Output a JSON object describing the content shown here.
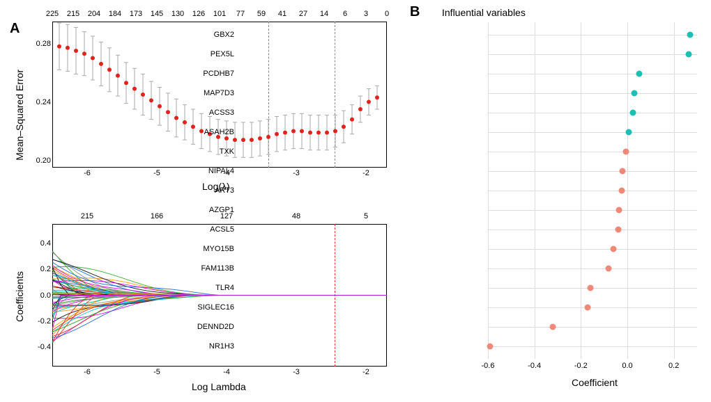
{
  "panels": {
    "A": "A",
    "B": "B"
  },
  "chart_data": [
    {
      "id": "panelA_top",
      "type": "line",
      "title": "",
      "xlabel": "Log(λ)",
      "ylabel": "Mean–Squared Error",
      "xlim": [
        -6.5,
        -1.7
      ],
      "ylim": [
        0.195,
        0.295
      ],
      "y_ticks": [
        0.2,
        0.24,
        0.28
      ],
      "top_axis_label": "",
      "top_ticks": [
        225,
        215,
        204,
        184,
        173,
        145,
        130,
        126,
        101,
        77,
        59,
        41,
        27,
        14,
        6,
        3,
        0
      ],
      "x": [
        -6.4,
        -6.28,
        -6.16,
        -6.04,
        -5.92,
        -5.8,
        -5.68,
        -5.56,
        -5.44,
        -5.32,
        -5.2,
        -5.08,
        -4.96,
        -4.84,
        -4.72,
        -4.6,
        -4.48,
        -4.36,
        -4.24,
        -4.12,
        -4.0,
        -3.88,
        -3.76,
        -3.64,
        -3.52,
        -3.4,
        -3.28,
        -3.16,
        -3.04,
        -2.92,
        -2.8,
        -2.68,
        -2.56,
        -2.44,
        -2.32,
        -2.2,
        -2.08,
        -1.96,
        -1.84
      ],
      "mse": [
        0.278,
        0.277,
        0.275,
        0.273,
        0.27,
        0.266,
        0.262,
        0.258,
        0.253,
        0.249,
        0.245,
        0.241,
        0.237,
        0.233,
        0.229,
        0.226,
        0.223,
        0.22,
        0.218,
        0.216,
        0.215,
        0.214,
        0.214,
        0.214,
        0.215,
        0.216,
        0.218,
        0.219,
        0.22,
        0.22,
        0.219,
        0.219,
        0.219,
        0.22,
        0.223,
        0.228,
        0.235,
        0.24,
        0.243
      ],
      "se": [
        0.016,
        0.016,
        0.016,
        0.015,
        0.015,
        0.015,
        0.015,
        0.014,
        0.014,
        0.014,
        0.014,
        0.013,
        0.013,
        0.013,
        0.013,
        0.012,
        0.012,
        0.012,
        0.012,
        0.012,
        0.012,
        0.012,
        0.012,
        0.012,
        0.012,
        0.012,
        0.012,
        0.012,
        0.012,
        0.012,
        0.012,
        0.012,
        0.012,
        0.011,
        0.011,
        0.01,
        0.009,
        0.009,
        0.008
      ],
      "vlines_log_lambda": [
        -3.4,
        -2.45
      ]
    },
    {
      "id": "panelA_bottom",
      "type": "line",
      "title": "",
      "xlabel": "Log Lambda",
      "ylabel": "Coefficients",
      "xlim": [
        -6.5,
        -1.7
      ],
      "ylim": [
        -0.55,
        0.55
      ],
      "y_ticks": [
        -0.4,
        -0.2,
        0.0,
        0.2,
        0.4
      ],
      "x_ticks": [
        -6,
        -5,
        -4,
        -3,
        -2
      ],
      "top_ticks": [
        215,
        166,
        127,
        48,
        5
      ],
      "top_tick_x": [
        -6,
        -5,
        -4,
        -3,
        -2
      ],
      "vline_log_lambda": -2.45,
      "note": "Hundreds of coefficient paths; individual series not enumerable from pixels"
    },
    {
      "id": "panelB",
      "type": "scatter",
      "title": "Influential variables",
      "xlabel": "Coefficient",
      "ylabel": "",
      "xlim": [
        -0.6,
        0.3
      ],
      "x_ticks": [
        -0.6,
        -0.4,
        -0.2,
        0.0,
        0.2
      ],
      "series": [
        {
          "name": "GBX2",
          "coef": 0.27,
          "sign": "pos"
        },
        {
          "name": "PEX5L",
          "coef": 0.265,
          "sign": "pos"
        },
        {
          "name": "PCDHB7",
          "coef": 0.05,
          "sign": "pos"
        },
        {
          "name": "MAP7D3",
          "coef": 0.03,
          "sign": "pos"
        },
        {
          "name": "ACSS3",
          "coef": 0.025,
          "sign": "pos"
        },
        {
          "name": "ASAH2B",
          "coef": 0.005,
          "sign": "pos"
        },
        {
          "name": "TXK",
          "coef": -0.005,
          "sign": "neg"
        },
        {
          "name": "NIPAL4",
          "coef": -0.02,
          "sign": "neg"
        },
        {
          "name": "ART3",
          "coef": -0.025,
          "sign": "neg"
        },
        {
          "name": "AZGP1",
          "coef": -0.035,
          "sign": "neg"
        },
        {
          "name": "ACSL5",
          "coef": -0.04,
          "sign": "neg"
        },
        {
          "name": "MYO15B",
          "coef": -0.06,
          "sign": "neg"
        },
        {
          "name": "FAM113B",
          "coef": -0.08,
          "sign": "neg"
        },
        {
          "name": "TLR4",
          "coef": -0.16,
          "sign": "neg"
        },
        {
          "name": "SIGLEC16",
          "coef": -0.17,
          "sign": "neg"
        },
        {
          "name": "DENND2D",
          "coef": -0.32,
          "sign": "neg"
        },
        {
          "name": "NR1H3",
          "coef": -0.59,
          "sign": "neg"
        }
      ],
      "colors": {
        "pos": "#1bbfb4",
        "neg": "#f08879"
      }
    }
  ]
}
